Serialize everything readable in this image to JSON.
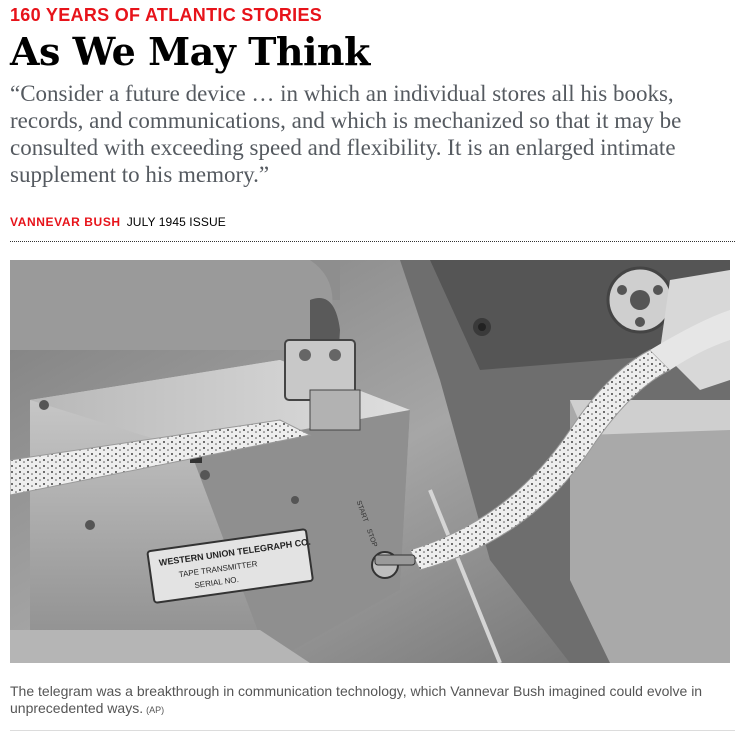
{
  "article": {
    "kicker": "160 YEARS OF ATLANTIC STORIES",
    "headline": "As We May Think",
    "dek": "“Consider a future device …  in which an individual stores all his books, records, and communications, and which is mechanized so that it may be consulted with exceeding speed and flexibility. It is an enlarged intimate supplement to his memory.”",
    "author": "VANNEVAR BUSH",
    "issue": "JULY 1945 ISSUE"
  },
  "photo": {
    "plate_line1": "WESTERN UNION TELEGRAPH CO.",
    "plate_line2": "TAPE TRANSMITTER",
    "plate_line3": "SERIAL NO.",
    "switch_label_start": "START",
    "switch_label_stop": "STOP"
  },
  "caption": {
    "text": "The telegram was a breakthrough in communication technology, which Vannevar Bush imagined could evolve in unprecedented ways.",
    "credit": "(AP)"
  },
  "colors": {
    "accent": "#e7131a",
    "dek": "#555a60",
    "caption": "#555555"
  }
}
